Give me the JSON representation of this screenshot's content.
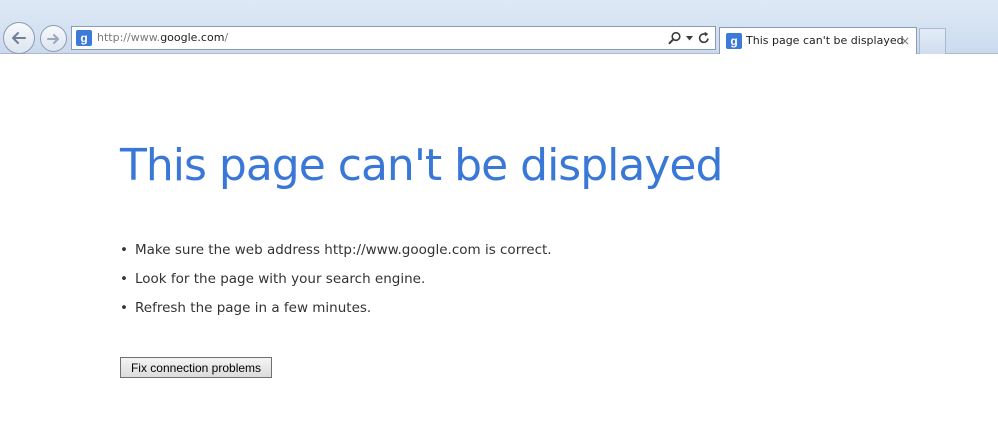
{
  "browser": {
    "address_prefix": "http://www.",
    "address_domain": "google.com",
    "address_suffix": "/",
    "favicon_letter": "g",
    "tab": {
      "title": "This page can't be displayed",
      "close_glyph": "×"
    }
  },
  "page": {
    "title": "This page can't be displayed",
    "suggestions": [
      "Make sure the web address http://www.google.com is correct.",
      "Look for the page with your search engine.",
      "Refresh the page in a few minutes."
    ],
    "bullet": "•",
    "fix_button_label": "Fix connection problems"
  },
  "colors": {
    "title_blue": "#3a78d8",
    "favicon_blue": "#3b7ad8"
  },
  "icons": {
    "back": "back-arrow-icon",
    "forward": "forward-arrow-icon",
    "search": "search-icon",
    "dropdown": "chevron-down-icon",
    "refresh": "refresh-icon",
    "close": "close-icon"
  }
}
